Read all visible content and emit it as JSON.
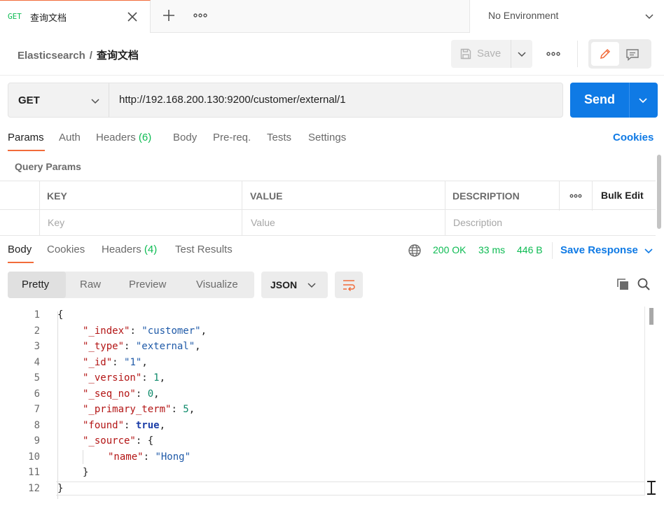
{
  "tab": {
    "method": "GET",
    "title": "查询文档"
  },
  "environment": {
    "label": "No Environment"
  },
  "header": {
    "breadcrumb_root": "Elasticsearch",
    "breadcrumb_sep": "/",
    "breadcrumb_current": "查询文档",
    "save_label": "Save"
  },
  "request": {
    "method": "GET",
    "url": "http://192.168.200.130:9200/customer/external/1",
    "send_label": "Send"
  },
  "request_tabs": {
    "params": "Params",
    "auth": "Auth",
    "headers": "Headers",
    "headers_count": "(6)",
    "body": "Body",
    "prereq": "Pre-req.",
    "tests": "Tests",
    "settings": "Settings",
    "cookies": "Cookies"
  },
  "query_params": {
    "title": "Query Params",
    "columns": {
      "key": "KEY",
      "value": "VALUE",
      "description": "DESCRIPTION",
      "bulk_edit": "Bulk Edit"
    },
    "placeholders": {
      "key": "Key",
      "value": "Value",
      "description": "Description"
    }
  },
  "response_tabs": {
    "body": "Body",
    "cookies": "Cookies",
    "headers": "Headers",
    "headers_count": "(4)",
    "test_results": "Test Results"
  },
  "response_meta": {
    "status": "200 OK",
    "time": "33 ms",
    "size": "446 B",
    "save_response": "Save Response"
  },
  "view_modes": {
    "pretty": "Pretty",
    "raw": "Raw",
    "preview": "Preview",
    "visualize": "Visualize",
    "format": "JSON"
  },
  "code_lines": [
    {
      "num": "1",
      "p1": "{"
    },
    {
      "num": "2",
      "key": "\"_index\"",
      "sep": ": ",
      "str": "\"customer\"",
      "end": ","
    },
    {
      "num": "3",
      "key": "\"_type\"",
      "sep": ": ",
      "str": "\"external\"",
      "end": ","
    },
    {
      "num": "4",
      "key": "\"_id\"",
      "sep": ": ",
      "str": "\"1\"",
      "end": ","
    },
    {
      "num": "5",
      "key": "\"_version\"",
      "sep": ": ",
      "val": "1",
      "end": ","
    },
    {
      "num": "6",
      "key": "\"_seq_no\"",
      "sep": ": ",
      "val": "0",
      "end": ","
    },
    {
      "num": "7",
      "key": "\"_primary_term\"",
      "sep": ": ",
      "val": "5",
      "end": ","
    },
    {
      "num": "8",
      "key": "\"found\"",
      "sep": ": ",
      "bool": "true",
      "end": ","
    },
    {
      "num": "9",
      "key": "\"_source\"",
      "sep": ": ",
      "end": "{"
    },
    {
      "num": "10",
      "key": "\"name\"",
      "sep": ": ",
      "str": "\"Hong\""
    },
    {
      "num": "11",
      "p1": "}"
    },
    {
      "num": "12",
      "p1": "}"
    }
  ]
}
